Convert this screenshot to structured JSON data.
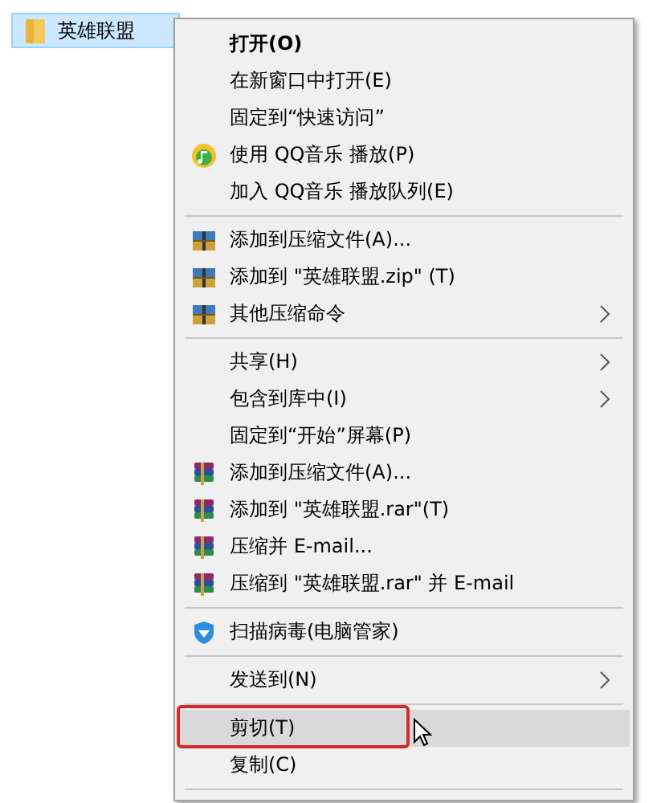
{
  "folder": {
    "name": "英雄联盟",
    "selected": true
  },
  "menu": {
    "items": [
      {
        "kind": "plain",
        "label": "打开(O)",
        "bold": true,
        "submenu": false,
        "selected": false
      },
      {
        "kind": "plain",
        "label": "在新窗口中打开(E)",
        "bold": false,
        "submenu": false,
        "selected": false
      },
      {
        "kind": "plain",
        "label": "固定到“快速访问”",
        "bold": false,
        "submenu": false,
        "selected": false
      },
      {
        "kind": "qq",
        "label": "使用 QQ音乐 播放(P)",
        "bold": false,
        "submenu": false,
        "selected": false
      },
      {
        "kind": "plain",
        "label": "加入 QQ音乐 播放队列(E)",
        "bold": false,
        "submenu": false,
        "selected": false
      },
      {
        "kind": "separator"
      },
      {
        "kind": "archive",
        "label": "添加到压缩文件(A)...",
        "bold": false,
        "submenu": false,
        "selected": false
      },
      {
        "kind": "archive",
        "label": "添加到 \"英雄联盟.zip\" (T)",
        "bold": false,
        "submenu": false,
        "selected": false
      },
      {
        "kind": "archive",
        "label": "其他压缩命令",
        "bold": false,
        "submenu": true,
        "selected": false
      },
      {
        "kind": "separator"
      },
      {
        "kind": "plain",
        "label": "共享(H)",
        "bold": false,
        "submenu": true,
        "selected": false
      },
      {
        "kind": "plain",
        "label": "包含到库中(I)",
        "bold": false,
        "submenu": true,
        "selected": false
      },
      {
        "kind": "plain",
        "label": "固定到“开始”屏幕(P)",
        "bold": false,
        "submenu": false,
        "selected": false
      },
      {
        "kind": "rar",
        "label": "添加到压缩文件(A)...",
        "bold": false,
        "submenu": false,
        "selected": false
      },
      {
        "kind": "rar",
        "label": "添加到 \"英雄联盟.rar\"(T)",
        "bold": false,
        "submenu": false,
        "selected": false
      },
      {
        "kind": "rar",
        "label": "压缩并 E-mail...",
        "bold": false,
        "submenu": false,
        "selected": false
      },
      {
        "kind": "rar",
        "label": "压缩到 \"英雄联盟.rar\" 并 E-mail",
        "bold": false,
        "submenu": false,
        "selected": false
      },
      {
        "kind": "separator"
      },
      {
        "kind": "shield",
        "label": "扫描病毒(电脑管家)",
        "bold": false,
        "submenu": false,
        "selected": false
      },
      {
        "kind": "separator"
      },
      {
        "kind": "plain",
        "label": "发送到(N)",
        "bold": false,
        "submenu": true,
        "selected": false
      },
      {
        "kind": "separator"
      },
      {
        "kind": "plain",
        "label": "剪切(T)",
        "bold": false,
        "submenu": false,
        "selected": true,
        "annotated": true
      },
      {
        "kind": "plain",
        "label": "复制(C)",
        "bold": false,
        "submenu": false,
        "selected": false
      },
      {
        "kind": "separator"
      }
    ]
  }
}
